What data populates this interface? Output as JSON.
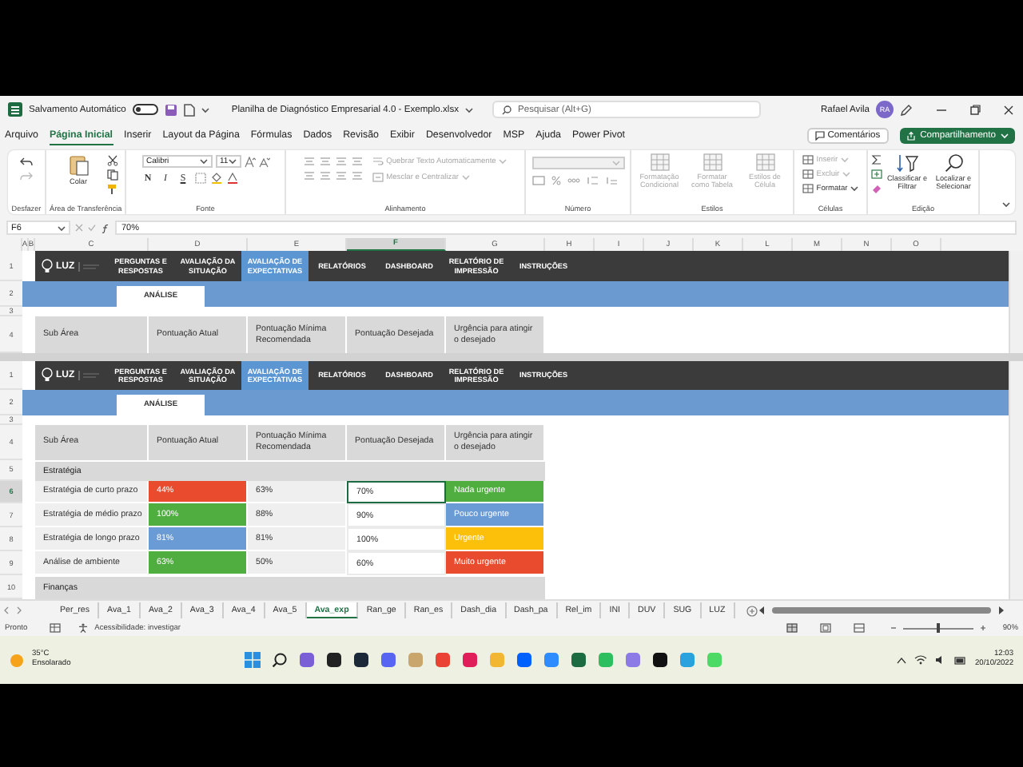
{
  "title_bar": {
    "autosave_label": "Salvamento Automático",
    "autosave_on": false,
    "document_title": "Planilha de Diagnóstico Empresarial 4.0 - Exemplo.xlsx",
    "search_placeholder": "Pesquisar (Alt+G)",
    "user_name": "Rafael Avila",
    "user_initials": "RA"
  },
  "menu": [
    {
      "label": "Arquivo",
      "selected": false
    },
    {
      "label": "Página Inicial",
      "selected": true
    },
    {
      "label": "Inserir",
      "selected": false
    },
    {
      "label": "Layout da Página",
      "selected": false
    },
    {
      "label": "Fórmulas",
      "selected": false
    },
    {
      "label": "Dados",
      "selected": false
    },
    {
      "label": "Revisão",
      "selected": false
    },
    {
      "label": "Exibir",
      "selected": false
    },
    {
      "label": "Desenvolvedor",
      "selected": false
    },
    {
      "label": "MSP",
      "selected": false
    },
    {
      "label": "Ajuda",
      "selected": false
    },
    {
      "label": "Power Pivot",
      "selected": false
    }
  ],
  "comments_button": "Comentários",
  "share_button": "Compartilhamento",
  "ribbon": [
    {
      "kind": "undo",
      "label": "Desfazer"
    },
    {
      "kind": "clipboard",
      "label": "Área de Transferência",
      "buttons": [
        {
          "kind": "large",
          "label": "Colar",
          "disabled": false
        }
      ]
    },
    {
      "kind": "font",
      "label": "Fonte",
      "font_name": "Calibri",
      "font_size": "11",
      "buttons": [
        {
          "kind": "glyph",
          "label": "N"
        },
        {
          "kind": "glyph",
          "label": "I"
        },
        {
          "kind": "glyph",
          "label": "S"
        }
      ]
    },
    {
      "kind": "alignment",
      "label": "Alinhamento",
      "buttons": [
        {
          "kind": "small",
          "label": "Quebrar Texto Automaticamente",
          "disabled": true
        },
        {
          "kind": "small",
          "label": "Mesclar e Centralizar",
          "disabled": true
        }
      ]
    },
    {
      "kind": "number",
      "label": "Número"
    },
    {
      "kind": "styles",
      "label": "Estilos",
      "buttons": [
        {
          "kind": "large",
          "label": "Formatação Condicional",
          "disabled": true
        },
        {
          "kind": "large",
          "label": "Formatar como Tabela",
          "disabled": true
        },
        {
          "kind": "large",
          "label": "Estilos de Célula",
          "disabled": true
        }
      ]
    },
    {
      "kind": "cells",
      "label": "Células",
      "buttons": [
        {
          "kind": "small",
          "label": "Inserir",
          "disabled": true
        },
        {
          "kind": "small",
          "label": "Excluir",
          "disabled": true
        },
        {
          "kind": "small",
          "label": "Formatar",
          "disabled": false
        }
      ]
    },
    {
      "kind": "editing",
      "label": "Edição",
      "buttons": [
        {
          "kind": "large",
          "label": "Classificar e Filtrar",
          "disabled": false
        },
        {
          "kind": "large",
          "label": "Localizar e Selecionar",
          "disabled": false
        }
      ]
    }
  ],
  "formula_bar": {
    "name_box": "F6",
    "formula": "70%"
  },
  "column_headers": [
    {
      "label": "A",
      "selected": false
    },
    {
      "label": "B",
      "selected": false
    },
    {
      "label": "C",
      "selected": false
    },
    {
      "label": "D",
      "selected": false
    },
    {
      "label": "E",
      "selected": false
    },
    {
      "label": "F",
      "selected": true
    },
    {
      "label": "G",
      "selected": false
    },
    {
      "label": "H",
      "selected": false
    },
    {
      "label": "I",
      "selected": false
    },
    {
      "label": "J",
      "selected": false
    },
    {
      "label": "K",
      "selected": false
    },
    {
      "label": "L",
      "selected": false
    },
    {
      "label": "M",
      "selected": false
    },
    {
      "label": "N",
      "selected": false
    },
    {
      "label": "O",
      "selected": false
    }
  ],
  "panes": [
    {
      "row_numbers": [
        "1",
        "2",
        "3",
        "4"
      ],
      "logo": "LUZ",
      "nav": [
        {
          "label": "PERGUNTAS E RESPOSTAS",
          "selected": false
        },
        {
          "label": "AVALIAÇÃO DA SITUAÇÃO",
          "selected": false
        },
        {
          "label": "AVALIAÇÃO DE EXPECTATIVAS",
          "selected": true
        },
        {
          "label": "RELATÓRIOS",
          "selected": false
        },
        {
          "label": "DASHBOARD",
          "selected": false
        },
        {
          "label": "RELATÓRIO DE IMPRESSÃO",
          "selected": false
        },
        {
          "label": "INSTRUÇÕES",
          "selected": false
        }
      ],
      "subtab": "ANÁLISE",
      "header": [
        "Sub Área",
        "Pontuação Atual",
        "Pontuação Mínima Recomendada",
        "Pontuação Desejada",
        "Urgência para atingir o desejado"
      ]
    },
    {
      "row_numbers": [
        "1",
        "2",
        "3",
        "4",
        "5",
        "6",
        "7",
        "8",
        "9",
        "10"
      ],
      "logo": "LUZ",
      "nav": [
        {
          "label": "PERGUNTAS E RESPOSTAS",
          "selected": false
        },
        {
          "label": "AVALIAÇÃO DA SITUAÇÃO",
          "selected": false
        },
        {
          "label": "AVALIAÇÃO DE EXPECTATIVAS",
          "selected": true
        },
        {
          "label": "RELATÓRIOS",
          "selected": false
        },
        {
          "label": "DASHBOARD",
          "selected": false
        },
        {
          "label": "RELATÓRIO DE IMPRESSÃO",
          "selected": false
        },
        {
          "label": "INSTRUÇÕES",
          "selected": false
        }
      ],
      "subtab": "ANÁLISE",
      "header": [
        "Sub Área",
        "Pontuação Atual",
        "Pontuação Mínima Recomendada",
        "Pontuação Desejada",
        "Urgência para atingir o desejado"
      ],
      "sections": [
        {
          "title": "Estratégia",
          "rows": [
            {
              "sub_area": "Estratégia de curto prazo",
              "current": {
                "text": "44%",
                "color": "#e84b2e"
              },
              "minimum": "63%",
              "desired": {
                "text": "70%",
                "selected": true
              },
              "urgency": {
                "text": "Nada urgente",
                "color": "#4fae3f"
              }
            },
            {
              "sub_area": "Estratégia de médio prazo",
              "current": {
                "text": "100%",
                "color": "#4fae3f"
              },
              "minimum": "88%",
              "desired": {
                "text": "90%",
                "selected": false
              },
              "urgency": {
                "text": "Pouco urgente",
                "color": "#6a9bd4"
              }
            },
            {
              "sub_area": "Estratégia de longo prazo",
              "current": {
                "text": "81%",
                "color": "#6a9bd4"
              },
              "minimum": "81%",
              "desired": {
                "text": "100%",
                "selected": false
              },
              "urgency": {
                "text": "Urgente",
                "color": "#fcbf0a"
              }
            },
            {
              "sub_area": "Análise de ambiente",
              "current": {
                "text": "63%",
                "color": "#4fae3f"
              },
              "minimum": "50%",
              "desired": {
                "text": "60%",
                "selected": false
              },
              "urgency": {
                "text": "Muito urgente",
                "color": "#e84b2e"
              }
            }
          ]
        },
        {
          "title": "Finanças"
        }
      ]
    }
  ],
  "sheet_tabs": [
    {
      "label": "Per_res",
      "selected": false
    },
    {
      "label": "Ava_1",
      "selected": false
    },
    {
      "label": "Ava_2",
      "selected": false
    },
    {
      "label": "Ava_3",
      "selected": false
    },
    {
      "label": "Ava_4",
      "selected": false
    },
    {
      "label": "Ava_5",
      "selected": false
    },
    {
      "label": "Ava_exp",
      "selected": true
    },
    {
      "label": "Ran_ge",
      "selected": false
    },
    {
      "label": "Ran_es",
      "selected": false
    },
    {
      "label": "Dash_dia",
      "selected": false
    },
    {
      "label": "Dash_pa",
      "selected": false
    },
    {
      "label": "Rel_im",
      "selected": false
    },
    {
      "label": "INI",
      "selected": false
    },
    {
      "label": "DUV",
      "selected": false
    },
    {
      "label": "SUG",
      "selected": false
    },
    {
      "label": "LUZ",
      "selected": false
    }
  ],
  "status_bar": {
    "status": "Pronto",
    "accessibility": "Acessibilidade: investigar",
    "zoom": {
      "label": "90%",
      "level": 0.5
    }
  },
  "taskbar": {
    "temperature": "35°C",
    "weather": "Ensolarado",
    "time": "12:03",
    "date": "20/10/2022"
  }
}
